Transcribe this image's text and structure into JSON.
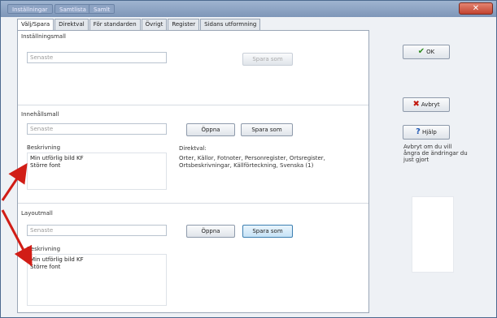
{
  "titlebar": {
    "tabs": [
      "Inställningar",
      "Samtlista",
      "Samlt"
    ],
    "close": "✕"
  },
  "tabs": [
    "Välj/Spara",
    "Direktval",
    "För standarden",
    "Övrigt",
    "Register",
    "Sidans utformning"
  ],
  "installningsmall": {
    "label": "Inställningsmall",
    "placeholder": "Senaste",
    "save": "Spara som"
  },
  "innehallsmall": {
    "label": "Innehållsmall",
    "placeholder": "Senaste",
    "open": "Öppna",
    "save": "Spara som",
    "desc_label": "Beskrivning",
    "desc": "Min utförlig bild KF\nStörre font",
    "direktval_label": "Direktval:",
    "direktval": "Orter, Källor, Fotnoter, Personregister, Ortsregister,\nOrtsbeskrivningar, Källförteckning, Svenska (1)"
  },
  "layoutmall": {
    "label": "Layoutmall",
    "placeholder": "Senaste",
    "open": "Öppna",
    "save": "Spara som",
    "desc_label": "Beskrivning",
    "desc": "Min utförlig bild KF\nStörre font"
  },
  "side": {
    "ok": "OK",
    "cancel": "Avbryt",
    "help": "Hjälp",
    "note": "Avbryt om du vill\nångra de ändringar du\njust gjort"
  },
  "colors": {
    "accent": "#3c7fb1",
    "arrow": "#d11d16",
    "ok_icon": "#2e8b1f",
    "cancel_icon": "#c21a10",
    "help_icon": "#1f57b3"
  }
}
